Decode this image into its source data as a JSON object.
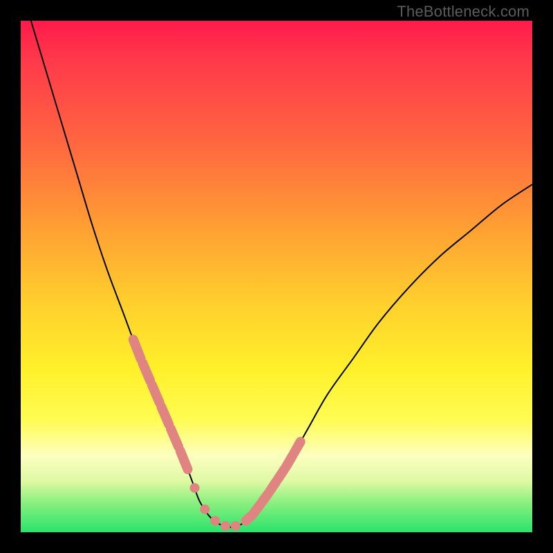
{
  "watermark": "TheBottleneck.com",
  "chart_data": {
    "type": "line",
    "title": "",
    "xlabel": "",
    "ylabel": "",
    "xlim": [
      0,
      100
    ],
    "ylim": [
      0,
      100
    ],
    "grid": false,
    "legend": false,
    "series": [
      {
        "name": "bottleneck-curve",
        "x": [
          2,
          5,
          8,
          11,
          14,
          17,
          20,
          23,
          26,
          29,
          32,
          33.5,
          35,
          37,
          39,
          41,
          43,
          45,
          48,
          52,
          56,
          60,
          65,
          70,
          76,
          82,
          88,
          94,
          100
        ],
        "y": [
          100,
          90,
          80,
          70,
          60,
          51,
          43,
          35,
          28,
          21,
          14,
          10,
          6,
          3,
          1.5,
          1,
          1.5,
          3,
          7,
          13,
          20,
          27,
          34,
          41,
          48,
          54,
          59,
          64,
          68
        ]
      }
    ],
    "markers": {
      "note": "pink marker cluster near the trough",
      "left_segment_x_range": [
        22,
        33
      ],
      "right_segment_x_range": [
        44,
        55
      ],
      "floor_dots_x": [
        34,
        36,
        38,
        40,
        42,
        44
      ]
    },
    "background_gradient": {
      "stops": [
        {
          "pos": 0.0,
          "color": "#ff1a4b"
        },
        {
          "pos": 0.4,
          "color": "#ff9e33"
        },
        {
          "pos": 0.68,
          "color": "#fff02a"
        },
        {
          "pos": 0.9,
          "color": "#def9a4"
        },
        {
          "pos": 1.0,
          "color": "#29e36b"
        }
      ]
    }
  }
}
